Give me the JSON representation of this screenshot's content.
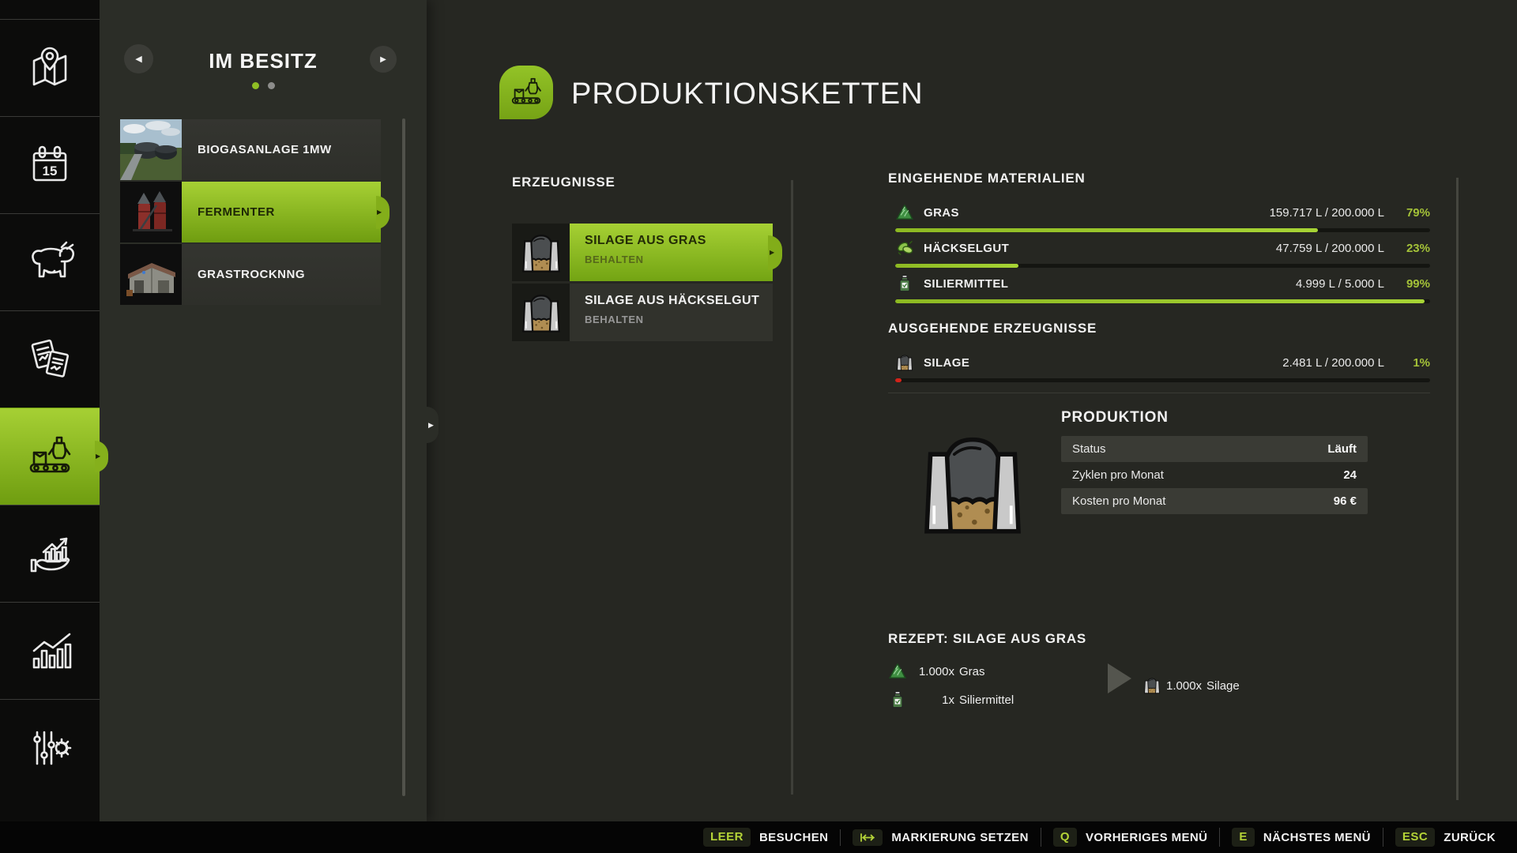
{
  "colors": {
    "accent": "#8fbf24",
    "percent_green": "#a4c238",
    "warning_red": "#d2231a"
  },
  "sidebar": {
    "calendar_day": "15",
    "items": [
      {
        "id": "map",
        "icon": "map-icon",
        "active": false
      },
      {
        "id": "calendar",
        "icon": "calendar-icon",
        "active": false
      },
      {
        "id": "animals",
        "icon": "cow-icon",
        "active": false
      },
      {
        "id": "contracts",
        "icon": "contracts-icon",
        "active": false
      },
      {
        "id": "production",
        "icon": "production-icon",
        "active": true
      },
      {
        "id": "finances",
        "icon": "finances-icon",
        "active": false
      },
      {
        "id": "statistics",
        "icon": "statistics-icon",
        "active": false
      },
      {
        "id": "settings",
        "icon": "settings-icon",
        "active": false
      }
    ]
  },
  "owned_panel": {
    "title": "IM BESITZ",
    "page_dots": 2,
    "active_dot": 0,
    "buildings": [
      {
        "label": "BIOGASANLAGE 1MW",
        "selected": false,
        "thumb": "biogas-plant-photo"
      },
      {
        "label": "FERMENTER",
        "selected": true,
        "thumb": "fermenter-silos-photo"
      },
      {
        "label": "GRASTROCKNNG",
        "selected": false,
        "thumb": "grass-drying-barn-photo"
      }
    ]
  },
  "header": {
    "title": "PRODUKTIONSKETTEN"
  },
  "products_panel": {
    "title": "ERZEUGNISSE",
    "items": [
      {
        "title": "SILAGE AUS GRAS",
        "subtitle": "BEHALTEN",
        "selected": true
      },
      {
        "title": "SILAGE AUS HÄCKSELGUT",
        "subtitle": "BEHALTEN",
        "selected": false
      }
    ]
  },
  "details": {
    "inputs_title": "EINGEHENDE MATERIALIEN",
    "inputs": [
      {
        "name": "GRAS",
        "amount": "159.717 L / 200.000 L",
        "percent": 79,
        "percent_label": "79%",
        "icon": "grass-icon"
      },
      {
        "name": "HÄCKSELGUT",
        "amount": "47.759 L / 200.000 L",
        "percent": 23,
        "percent_label": "23%",
        "icon": "chaff-icon"
      },
      {
        "name": "SILIERMITTEL",
        "amount": "4.999 L / 5.000 L",
        "percent": 99,
        "percent_label": "99%",
        "icon": "silage-additive-icon"
      }
    ],
    "outputs_title": "AUSGEHENDE ERZEUGNISSE",
    "outputs": [
      {
        "name": "SILAGE",
        "amount": "2.481 L / 200.000 L",
        "percent": 1,
        "percent_label": "1%",
        "icon": "bunker-silo-icon"
      }
    ],
    "production": {
      "title": "PRODUKTION",
      "rows": [
        {
          "label": "Status",
          "value": "Läuft"
        },
        {
          "label": "Zyklen pro Monat",
          "value": "24"
        },
        {
          "label": "Kosten pro Monat",
          "value": "96 €"
        }
      ]
    },
    "recipe": {
      "title": "REZEPT: SILAGE AUS GRAS",
      "inputs": [
        {
          "qty": "1.000x",
          "name": "Gras",
          "icon": "grass-icon"
        },
        {
          "qty": "1x",
          "name": "Siliermittel",
          "icon": "silage-additive-icon"
        }
      ],
      "outputs": [
        {
          "qty": "1.000x",
          "name": "Silage",
          "icon": "bunker-silo-icon"
        }
      ]
    }
  },
  "bottom_bar": {
    "controls": [
      {
        "key": "LEER",
        "label": "BESUCHEN"
      },
      {
        "key": "",
        "key_icon": "tab-key-icon",
        "label": "MARKIERUNG SETZEN"
      },
      {
        "key": "Q",
        "label": "VORHERIGES MENÜ"
      },
      {
        "key": "E",
        "label": "NÄCHSTES MENÜ"
      },
      {
        "key": "ESC",
        "label": "ZURÜCK"
      }
    ]
  }
}
